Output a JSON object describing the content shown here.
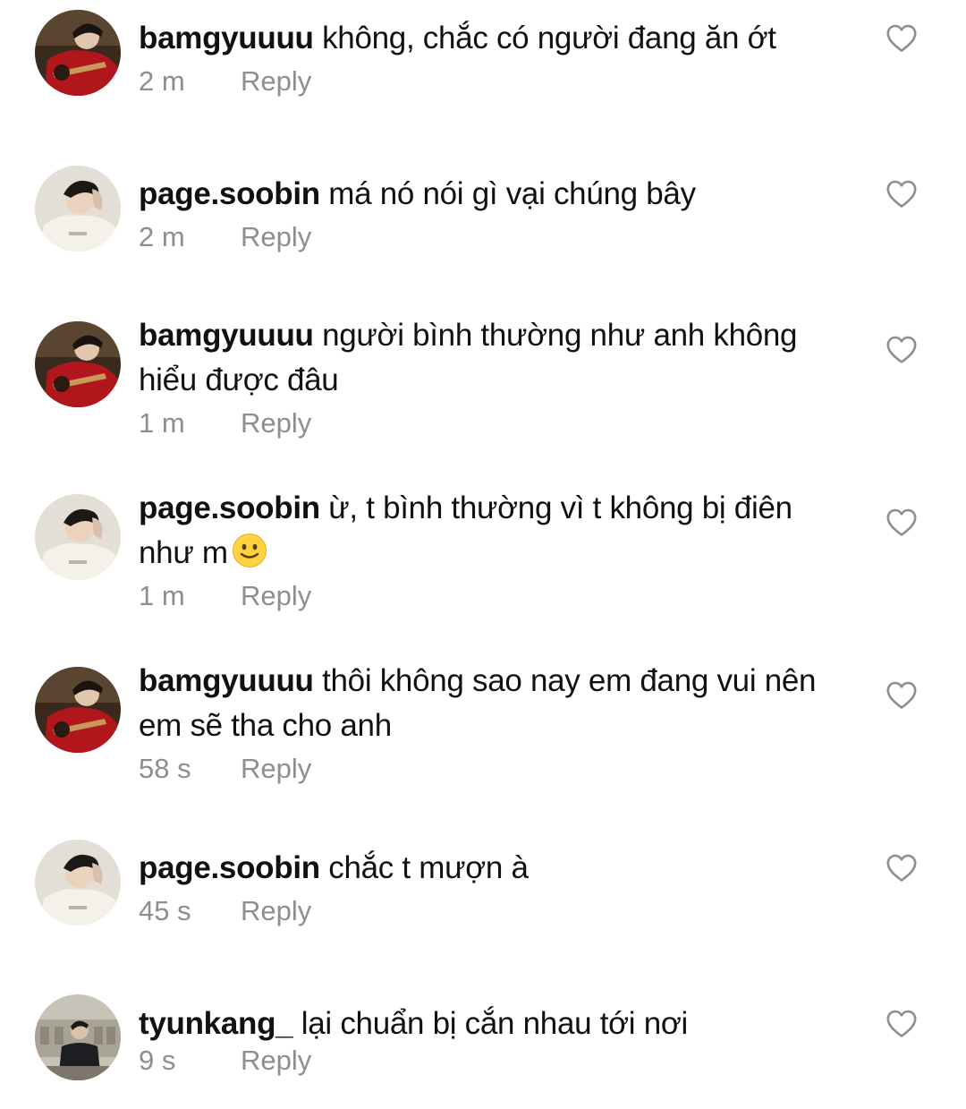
{
  "comments": [
    {
      "username": "bamgyuuuu",
      "text": "không, chắc có người đang ăn ớt",
      "time": "2 m",
      "reply": "Reply",
      "avatar_icon": "avatar-red-sweater-guitar"
    },
    {
      "username": "page.soobin",
      "text": "má nó nói gì vại chúng bây",
      "time": "2 m",
      "reply": "Reply",
      "avatar_icon": "avatar-white-sweater"
    },
    {
      "username": "bamgyuuuu",
      "text": "người bình thường như anh không hiểu được đâu",
      "time": "1 m",
      "reply": "Reply",
      "avatar_icon": "avatar-red-sweater-guitar"
    },
    {
      "username": "page.soobin",
      "text": "ừ, t bình thường vì t không bị điên như m",
      "emoji": "slightly-smiling-face-icon",
      "time": "1 m",
      "reply": "Reply",
      "avatar_icon": "avatar-white-sweater"
    },
    {
      "username": "bamgyuuuu",
      "text": "thôi không sao nay em đang vui nên em sẽ tha cho anh",
      "time": "58 s",
      "reply": "Reply",
      "avatar_icon": "avatar-red-sweater-guitar"
    },
    {
      "username": "page.soobin",
      "text": "chắc t mượn à",
      "time": "45 s",
      "reply": "Reply",
      "avatar_icon": "avatar-white-sweater"
    },
    {
      "username": "tyunkang_",
      "text": "lại chuẩn bị cắn nhau tới nơi",
      "time": "9 s",
      "reply": "Reply",
      "avatar_icon": "avatar-dark-coat-building"
    }
  ],
  "icons": {
    "like": "heart-outline-icon"
  },
  "colors": {
    "text": "#111111",
    "meta": "#8e8e8e",
    "heart_stroke": "#8e8e8e",
    "background": "#ffffff"
  }
}
